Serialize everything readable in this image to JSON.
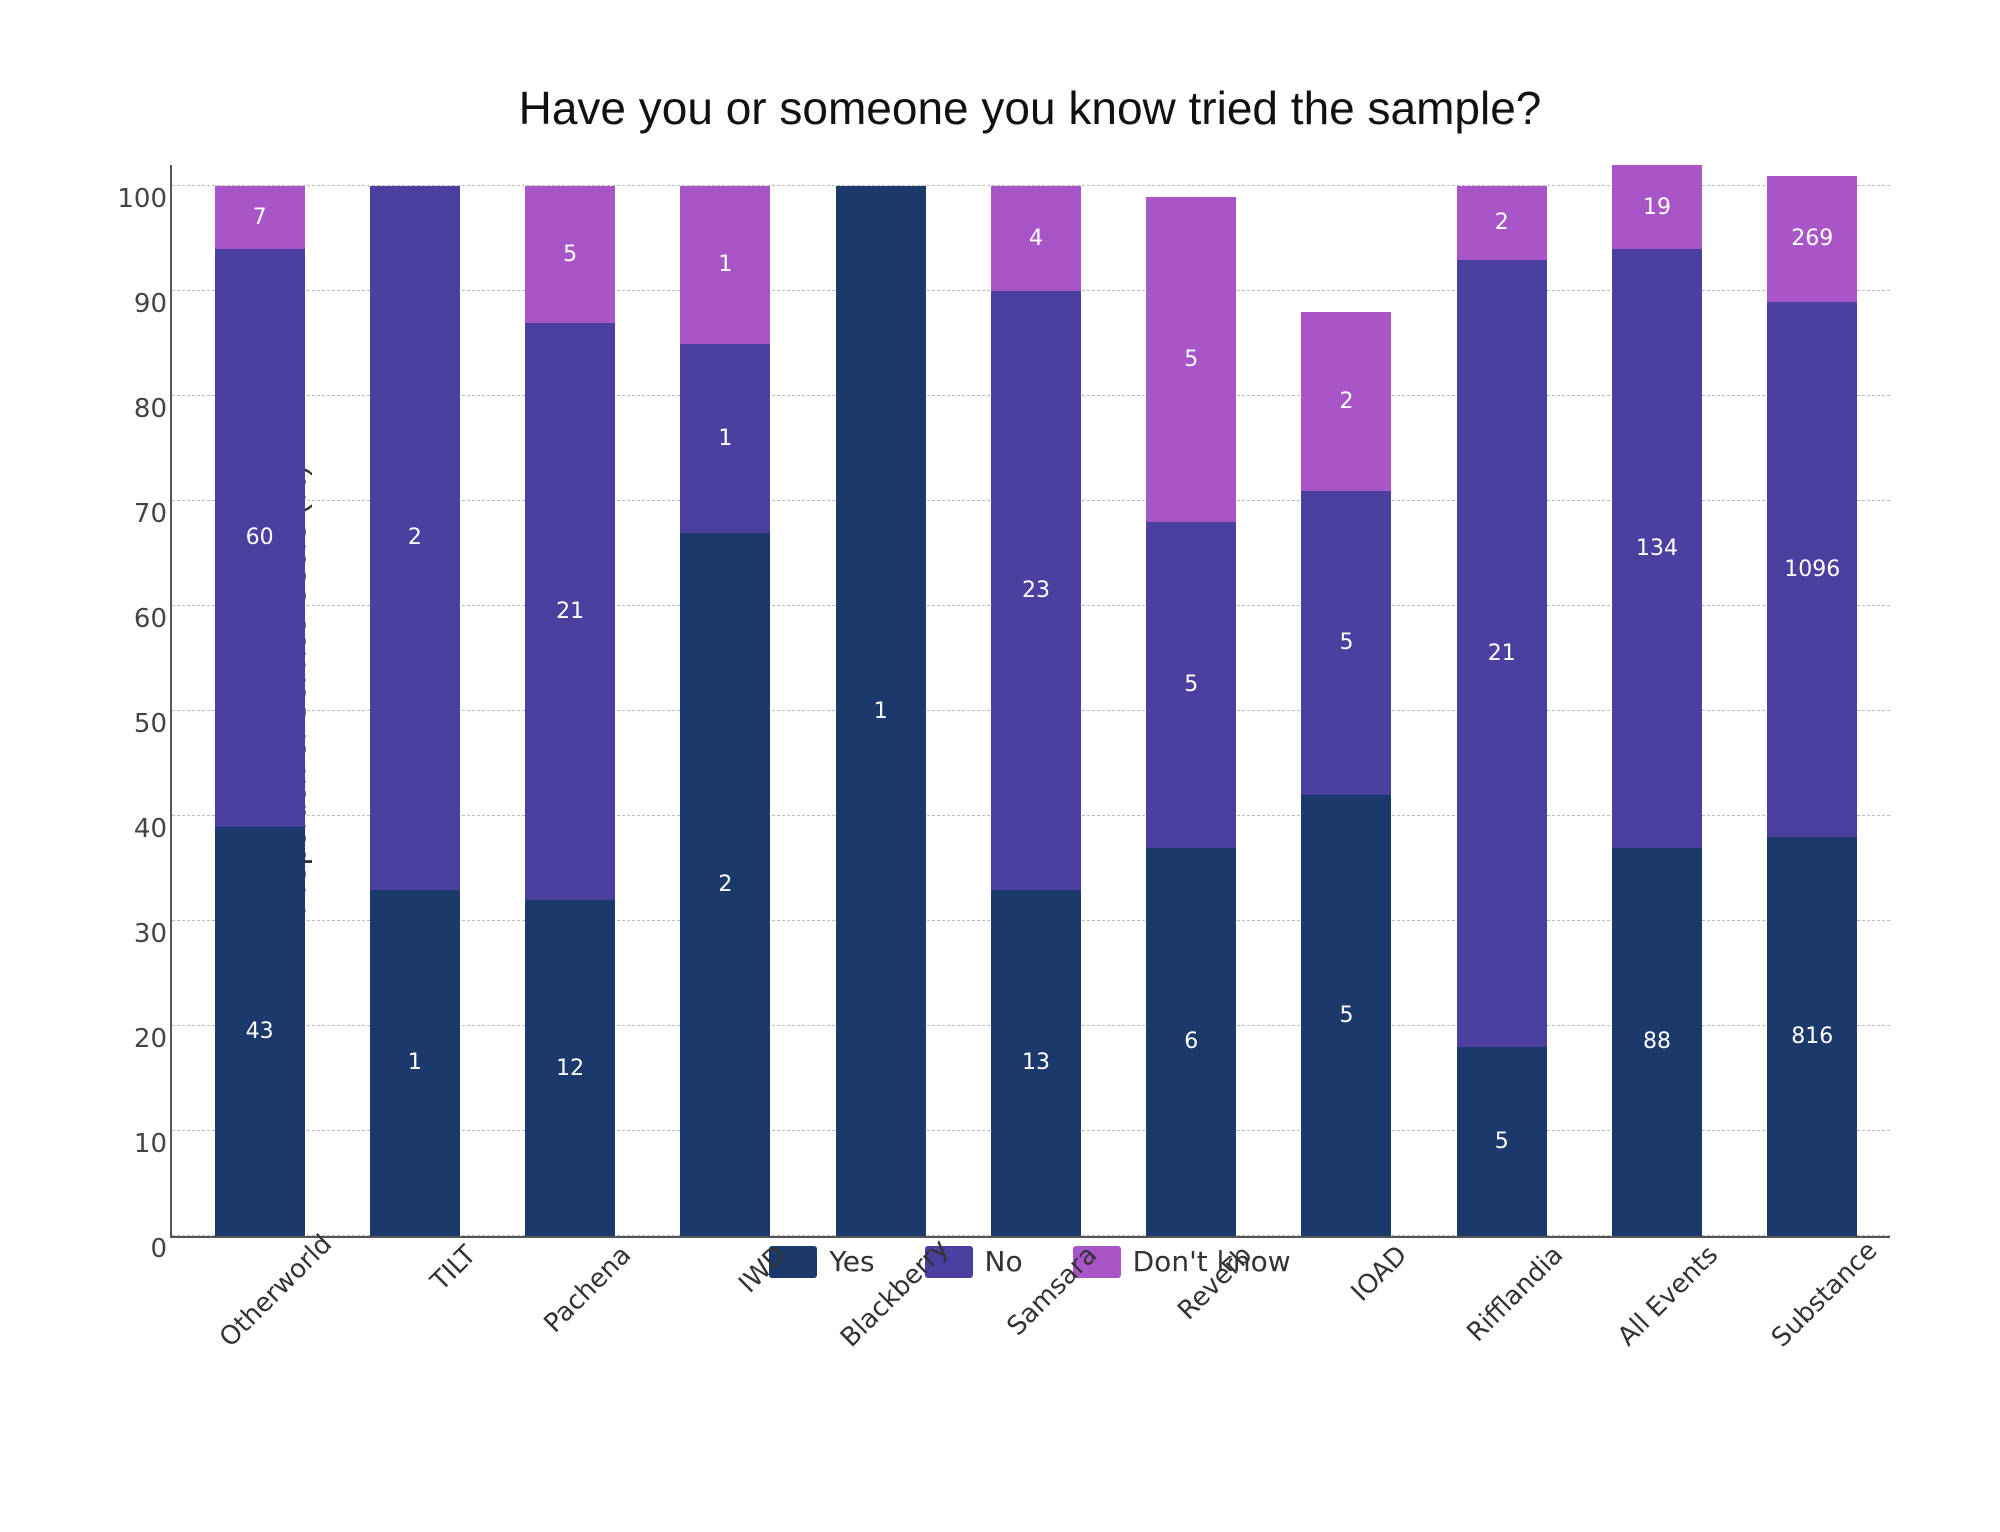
{
  "title": "Have you or someone you know tried the sample?",
  "yAxisLabel": "Proportion of Service Users (%)",
  "yTicks": [
    0,
    10,
    20,
    30,
    40,
    50,
    60,
    70,
    80,
    90,
    100
  ],
  "colors": {
    "yes": "#1b3a6b",
    "no": "#4b3fa0",
    "dontknow": "#a855c8"
  },
  "legend": [
    {
      "label": "Yes",
      "color": "#1b3a6b"
    },
    {
      "label": "No",
      "color": "#4b3fa0"
    },
    {
      "label": "Don't know",
      "color": "#a855c8"
    }
  ],
  "bars": [
    {
      "name": "Otherworld",
      "yes": 43,
      "yesPct": 39,
      "no": 60,
      "noPct": 55,
      "dontknow": 7,
      "dontknowPct": 6
    },
    {
      "name": "TILT",
      "yes": 1,
      "yesPct": 33,
      "no": 2,
      "noPct": 67,
      "dontknow": 0,
      "dontknowPct": 0
    },
    {
      "name": "Pachena",
      "yes": 12,
      "yesPct": 32,
      "no": 21,
      "noPct": 55,
      "dontknow": 5,
      "dontknowPct": 13
    },
    {
      "name": "IWD",
      "yes": 2,
      "yesPct": 67,
      "no": 1,
      "noPct": 18,
      "dontknow": 1,
      "dontknowPct": 15
    },
    {
      "name": "Blackberry",
      "yes": 1,
      "yesPct": 100,
      "no": 0,
      "noPct": 0,
      "dontknow": 0,
      "dontknowPct": 0
    },
    {
      "name": "Samsara",
      "yes": 13,
      "yesPct": 33,
      "no": 23,
      "noPct": 57,
      "dontknow": 4,
      "dontknowPct": 10
    },
    {
      "name": "Reverb",
      "yes": 6,
      "yesPct": 37,
      "no": 5,
      "noPct": 31,
      "dontknow": 5,
      "dontknowPct": 31
    },
    {
      "name": "IOAD",
      "yes": 5,
      "yesPct": 42,
      "no": 5,
      "noPct": 29,
      "dontknow": 2,
      "dontknowPct": 17
    },
    {
      "name": "Rifflandia",
      "yes": 5,
      "yesPct": 18,
      "no": 21,
      "noPct": 75,
      "dontknow": 2,
      "dontknowPct": 7
    },
    {
      "name": "All Events",
      "yes": 88,
      "yesPct": 37,
      "no": 134,
      "noPct": 57,
      "dontknow": 19,
      "dontknowPct": 8
    },
    {
      "name": "Substance",
      "yes": 816,
      "yesPct": 38,
      "no": 1096,
      "noPct": 51,
      "dontknow": 269,
      "dontknowPct": 12
    }
  ]
}
